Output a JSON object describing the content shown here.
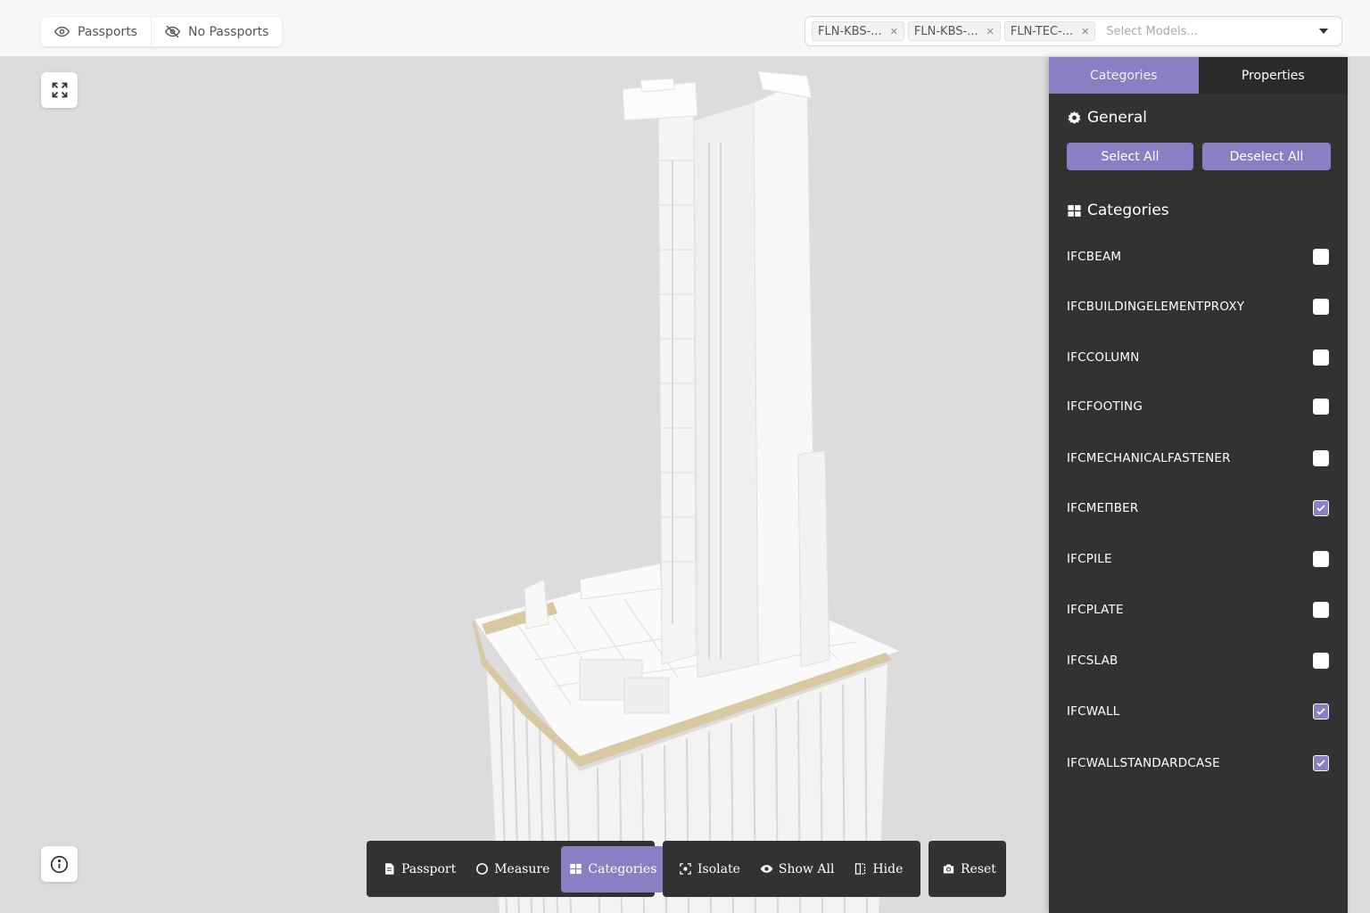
{
  "topbar": {
    "passports_label": "Passports",
    "no_passports_label": "No Passports",
    "model_tags": [
      "FLN-KBS-...",
      "FLN-KBS-...",
      "FLN-TEC-..."
    ],
    "model_placeholder": "Select Models..."
  },
  "toolbar": {
    "passport": "Passport",
    "measure": "Measure",
    "categories": "Categories",
    "isolate": "Isolate",
    "show_all": "Show All",
    "hide": "Hide",
    "reset": "Reset",
    "active": "categories"
  },
  "panel": {
    "tabs": [
      {
        "label": "Categories",
        "active": true
      },
      {
        "label": "Properties",
        "active": false
      }
    ],
    "general_title": "General",
    "select_all": "Select All",
    "deselect_all": "Deselect All",
    "categories_title": "Categories",
    "categories": [
      {
        "name": "IFCBEAM",
        "checked": false
      },
      {
        "name": "IFCBUILDINGELEMENTPROXY",
        "checked": false
      },
      {
        "name": "IFCCOLUMN",
        "checked": false
      },
      {
        "name": "IFCFOOTING",
        "checked": false
      },
      {
        "name": "IFCMECHANICALFASTENER",
        "checked": false
      },
      {
        "name": "IFCMEΠBER",
        "checked": true
      },
      {
        "name": "IFCPILE",
        "checked": false
      },
      {
        "name": "IFCPLATE",
        "checked": false
      },
      {
        "name": "IFCSLAB",
        "checked": false
      },
      {
        "name": "IFCWALL",
        "checked": true
      },
      {
        "name": "IFCWALLSTANDARDCASE",
        "checked": true
      }
    ]
  },
  "colors": {
    "accent": "#8b7fc4",
    "panel_bg": "#323232",
    "viewport_bg": "#dcdcdc",
    "slab_edge": "#d9c9a3"
  },
  "icons": {
    "passports": "eye-icon",
    "no_passports": "eye-slash-icon",
    "fullscreen": "expand-icon",
    "info": "info-icon",
    "general": "gear-icon",
    "categories": "grid-icon"
  }
}
